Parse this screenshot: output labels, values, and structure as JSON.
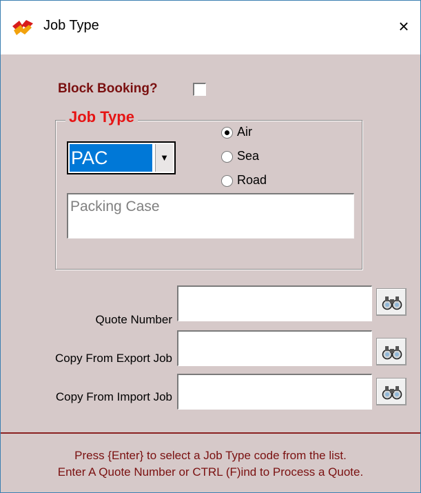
{
  "window": {
    "title": "Job Type",
    "close_label": "×"
  },
  "block_booking": {
    "label": "Block Booking?",
    "checked": false
  },
  "job_type_group": {
    "legend": "Job Type",
    "code_value": "PAC",
    "description": "Packing Case",
    "transport_modes": [
      {
        "label": "Air",
        "selected": true
      },
      {
        "label": "Sea",
        "selected": false
      },
      {
        "label": "Road",
        "selected": false
      }
    ]
  },
  "fields": {
    "quote_number": {
      "label": "Quote Number",
      "value": ""
    },
    "copy_export": {
      "label": "Copy From Export Job",
      "value": ""
    },
    "copy_import": {
      "label": "Copy From Import Job",
      "value": ""
    }
  },
  "help_text": {
    "line1": "Press {Enter} to select a Job Type code from the list.",
    "line2": "Enter A Quote Number or CTRL (F)ind to Process a Quote."
  },
  "icons": {
    "app": "app-logo-icon",
    "combo": "chevron-down-icon",
    "find": "binoculars-icon"
  },
  "colors": {
    "background": "#d6c9c9",
    "label_dark_red": "#7a1010",
    "legend_red": "#e61414",
    "selection_blue": "#0078d7"
  }
}
